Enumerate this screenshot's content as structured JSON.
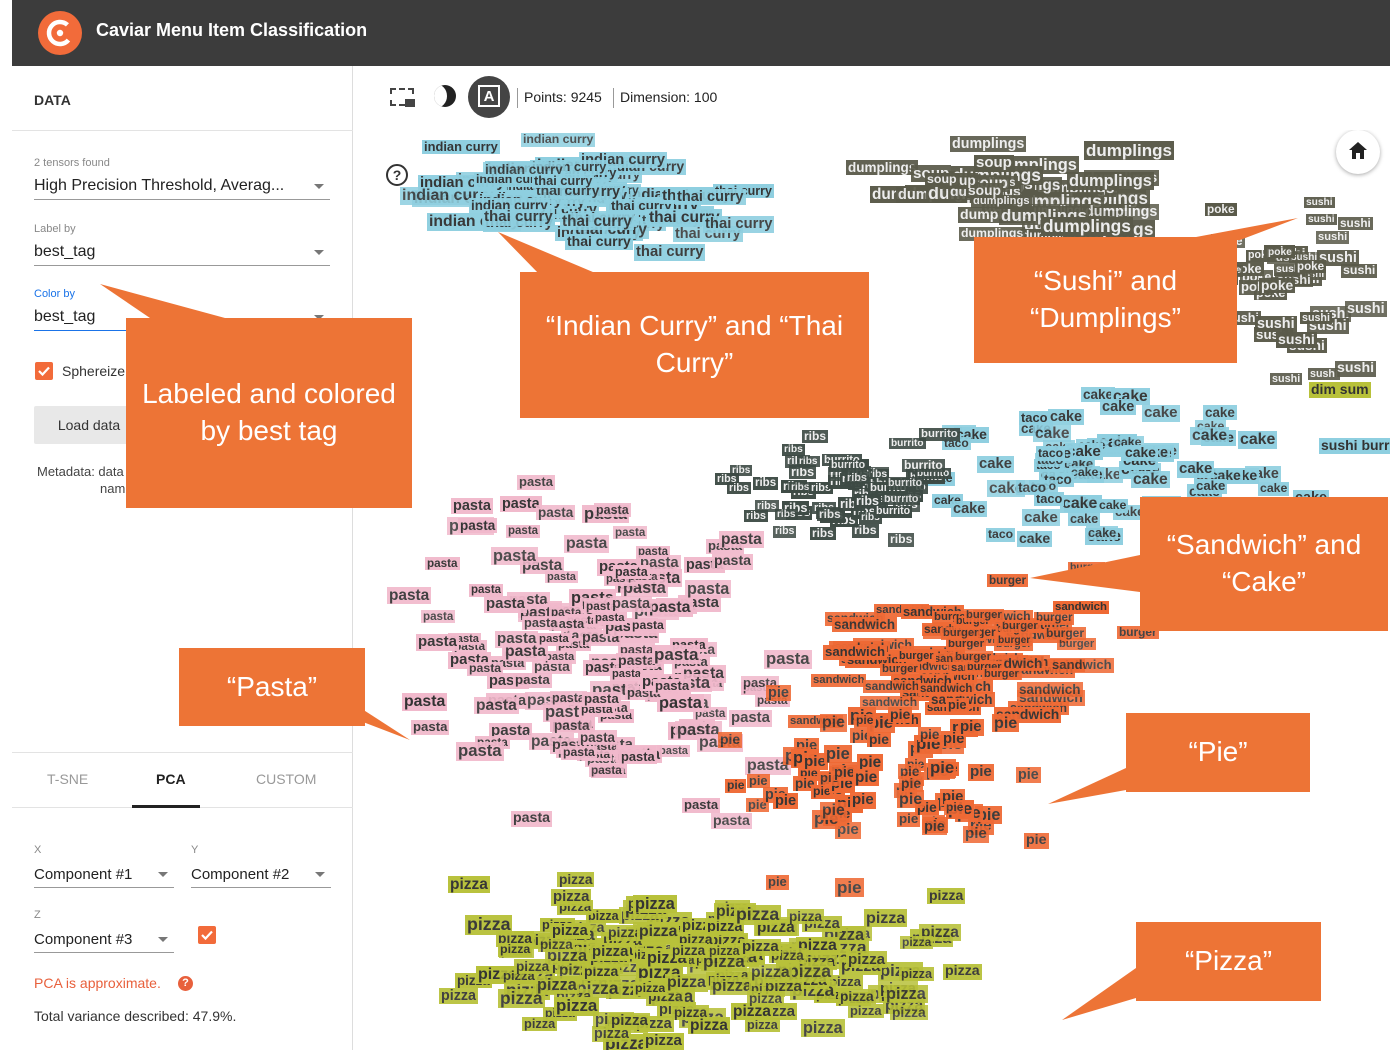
{
  "header": {
    "title": "Caviar Menu Item Classification"
  },
  "data_panel": {
    "section_title": "DATA",
    "tensors_found": "2 tensors found",
    "tensor_value": "High Precision Threshold, Averag...",
    "label_by_label": "Label by",
    "label_by_value": "best_tag",
    "color_by_label": "Color by",
    "color_by_value": "best_tag",
    "sphereize_label": "Sphereize",
    "load_button": "Load data",
    "metadata_label": "Metadata: data",
    "metadata_cont": "nam"
  },
  "projection": {
    "tabs": [
      "T-SNE",
      "PCA",
      "CUSTOM"
    ],
    "active_tab": "PCA",
    "x_label": "X",
    "x_value": "Component #1",
    "y_label": "Y",
    "y_value": "Component #2",
    "z_label": "Z",
    "z_value": "Component #3",
    "warning": "PCA is approximate.",
    "help": "?",
    "variance": "Total variance described: 47.9%."
  },
  "toolbar": {
    "points": "Points: 9245",
    "dimension": "Dimension: 100",
    "label_mode": "A"
  },
  "callouts": {
    "curry": "“Indian Curry” and “Thai Curry”",
    "sushi": "“Sushi” and “Dumplings”",
    "labeled": "Labeled and colored by best tag",
    "sandwich": "“Sandwich” and “Cake”",
    "pasta": "“Pasta”",
    "pie": "“Pie”",
    "pizza": "“Pizza”"
  },
  "tags": {
    "indian_curry": "indian curry",
    "thai_curry": "thai curry",
    "dumplings": "dumplings",
    "sushi": "sushi",
    "cake": "cake",
    "soup": "soup",
    "poke": "poke",
    "dim_sum": "dim sum",
    "sushi_burrito": "sushi burrito",
    "taco": "taco",
    "ribs": "ribs",
    "burrito": "burrito",
    "burger": "burger",
    "sandwich": "sandwich",
    "pasta": "pasta",
    "pie": "pie",
    "pizza": "pizza"
  },
  "colors": {
    "curry": "#8ecfe0",
    "dumplings": "#5a5a4a",
    "cake": "#8ecfe0",
    "sandwich": "#ef6a35",
    "pasta": "#f1b9cc",
    "pie": "#ef6a35",
    "pizza": "#b8c13a",
    "ribs": "#3d4a44",
    "callout": "#ed7436",
    "accent": "#f26b3a"
  }
}
